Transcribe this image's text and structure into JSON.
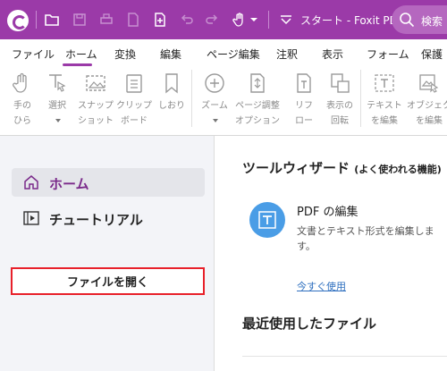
{
  "titlebar": {
    "title": "スタート - Foxit PDF...",
    "search_label": "検索",
    "icons": [
      "logo-icon",
      "open-folder-icon",
      "save-icon",
      "print-icon",
      "file-icon",
      "new-file-icon",
      "undo-icon",
      "redo-icon",
      "hand-icon",
      "dropdown-icon",
      "quick-access-icon"
    ]
  },
  "menubar": {
    "items": [
      {
        "label": "ファイル"
      },
      {
        "label": "ホーム"
      },
      {
        "label": "変換"
      },
      {
        "label": "編集"
      },
      {
        "label": "ページ編集"
      },
      {
        "label": "注釈"
      },
      {
        "label": "表示"
      },
      {
        "label": "フォーム"
      },
      {
        "label": "保護"
      }
    ],
    "active": "ホーム"
  },
  "ribbon": {
    "buttons": [
      {
        "label": "手の\nひら",
        "icon": "hand-icon"
      },
      {
        "label": "選択",
        "icon": "select-icon",
        "dropdown": true
      },
      {
        "label": "スナップ\nショット",
        "icon": "snapshot-icon"
      },
      {
        "label": "クリップ\nボード",
        "icon": "clipboard-icon",
        "dropdown": true
      },
      {
        "label": "しおり",
        "icon": "bookmark-icon"
      },
      {
        "label": "ズーム",
        "icon": "zoom-icon",
        "dropdown": true
      },
      {
        "label": "ページ調整\nオプション",
        "icon": "page-fit-icon",
        "dropdown": true
      },
      {
        "label": "リフ\nロー",
        "icon": "reflow-icon"
      },
      {
        "label": "表示の\n回転",
        "icon": "rotate-view-icon",
        "dropdown": true
      },
      {
        "label": "テキスト\nを編集",
        "icon": "edit-text-icon"
      },
      {
        "label": "オブジェク\nを編集",
        "icon": "edit-object-icon",
        "dropdown": true
      }
    ]
  },
  "sidebar": {
    "home_label": "ホーム",
    "tutorial_label": "チュートリアル",
    "open_file_label": "ファイルを開く"
  },
  "main": {
    "wizard_title": "ツールウィザード",
    "wizard_subtitle": "(よく使われる機能)",
    "card": {
      "title": "PDF の編集",
      "description": "文書とテキスト形式を編集します。",
      "link": "今すぐ使用"
    },
    "recent_title": "最近使用したファイル"
  },
  "colors": {
    "brand": "#9b3aa8",
    "open_button_border": "#e8202a",
    "card_icon": "#4a9de6",
    "link": "#2e6fbf"
  }
}
